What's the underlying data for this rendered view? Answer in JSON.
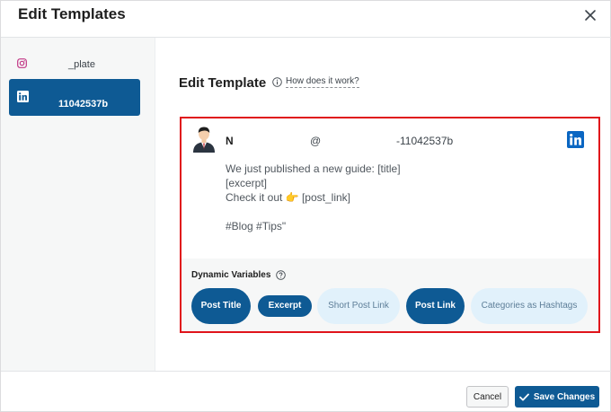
{
  "modal": {
    "title": "Edit Templates"
  },
  "sidebar": {
    "items": [
      {
        "label": "_plate",
        "icon": "instagram-icon"
      },
      {
        "label": "11042537b",
        "icon": "linkedin-icon",
        "active": true
      }
    ]
  },
  "content": {
    "title": "Edit Template",
    "help_link": "How does it work?"
  },
  "preview": {
    "name": "N",
    "at": "@",
    "handle": "-11042537b",
    "body_lines": [
      "We just published a new guide: [title]",
      "[excerpt]",
      "Check it out 👉 [post_link]",
      "",
      "#Blog #Tips\""
    ]
  },
  "dynamic_variables": {
    "heading": "Dynamic Variables",
    "pills": [
      {
        "label": "Post Title",
        "style": "dark"
      },
      {
        "label": "Excerpt",
        "style": "dark"
      },
      {
        "label": "Short Post Link",
        "style": "light"
      },
      {
        "label": "Post Link",
        "style": "dark"
      },
      {
        "label": "Categories as Hashtags",
        "style": "light"
      }
    ]
  },
  "footer": {
    "cancel_label": "Cancel",
    "save_label": "Save Changes"
  },
  "colors": {
    "accent": "#0e5a94",
    "highlight_border": "#e0141b",
    "pill_light_bg": "#e1f1fb"
  }
}
